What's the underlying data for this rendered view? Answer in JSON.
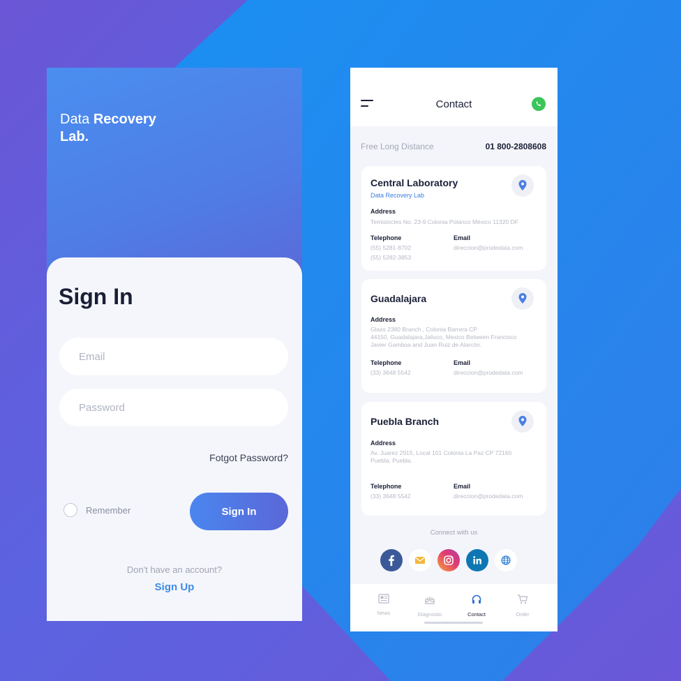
{
  "signin": {
    "brand_light": "Data",
    "brand_bold": "Recovery",
    "brand_bold2": "Lab.",
    "title": "Sign In",
    "email_placeholder": "Email",
    "password_placeholder": "Password",
    "forgot": "Fotgot Password?",
    "remember": "Remember",
    "signin_button": "Sign In",
    "no_account": "Don't have an account?",
    "signup": "Sign Up"
  },
  "contact": {
    "title": "Contact",
    "free_label": "Free Long Distance",
    "free_number": "01 800-2808608",
    "cards": [
      {
        "name": "Central Laboratory",
        "subtitle": "Data Recovery Lab",
        "address_label": "Address",
        "address": "Temistocles No. 23-9 Colonia Polanco México 11320 DF",
        "telephone_label": "Telephone",
        "telephone_1": "(55) 5281-8702",
        "telephone_2": "(55) 5282-3853",
        "email_label": "Email",
        "email": "direccion@prodedata.com"
      },
      {
        "name": "Guadalajara",
        "address_label": "Address",
        "address_1": "Glass 2380 Branch , Colonia Barrera CP",
        "address_2": "44150, Guadalajara,Jalisco, Mexico Between Francisco",
        "address_3": "Javier Gamboa and Juan Ruiz de Alarcón.",
        "telephone_label": "Telephone",
        "telephone": "(33) 3648 5542",
        "email_label": "Email",
        "email": "direccion@prodedata.com"
      },
      {
        "name": "Puebla Branch",
        "address_label": "Address",
        "address_1": "Av. Juarez 2915, Local 101 Colonia La Paz CP 72160",
        "address_2": "Puebla, Puebla.",
        "telephone_label": "Telephone",
        "telephone": "(33) 3648 5542",
        "email_label": "Email",
        "email": "direccion@prodedata.com"
      }
    ],
    "connect": "Connect with us",
    "social": [
      "facebook-icon",
      "mail-icon",
      "instagram-icon",
      "linkedin-icon",
      "globe-icon"
    ],
    "tabs": [
      {
        "label": "News",
        "icon": "newspaper-icon"
      },
      {
        "label": "Diagnostic",
        "icon": "cake-icon"
      },
      {
        "label": "Contact",
        "icon": "headset-icon",
        "active": true
      },
      {
        "label": "Order",
        "icon": "cart-icon"
      }
    ]
  },
  "colors": {
    "accent_blue": "#3d8ce6",
    "whatsapp": "#3cc55b",
    "text_dark": "#1a1f36",
    "muted": "#b5b9c6"
  }
}
